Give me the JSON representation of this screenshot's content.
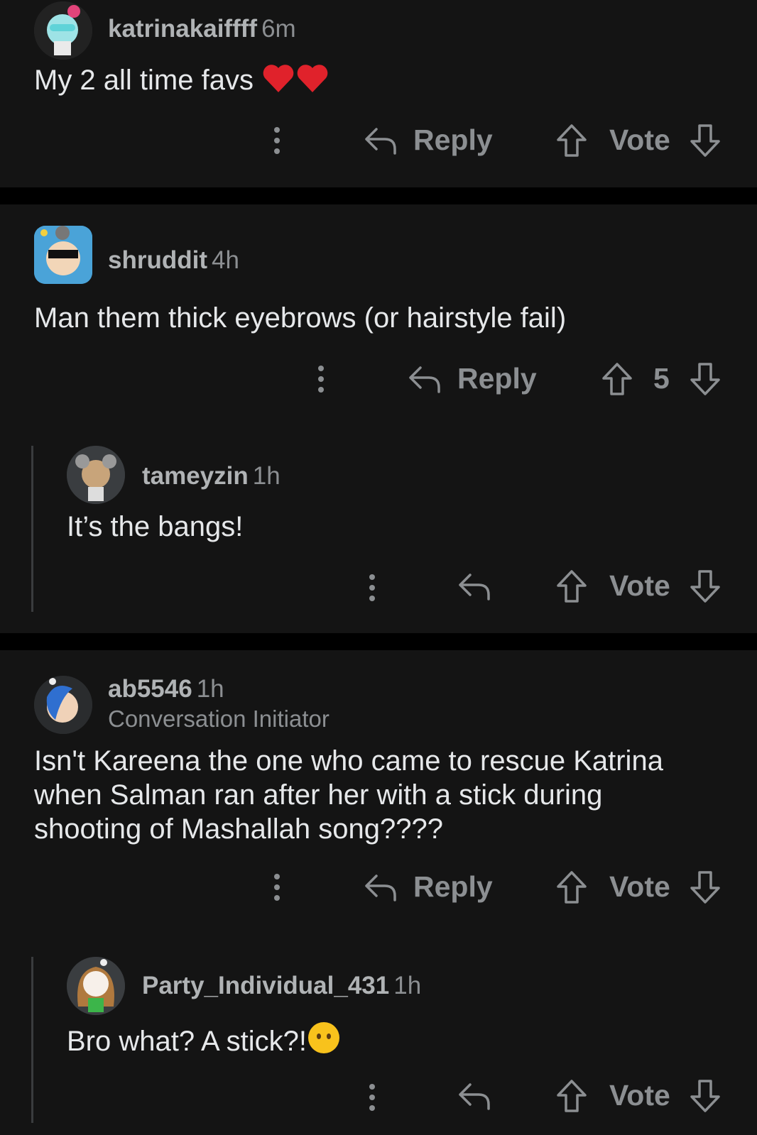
{
  "comments": [
    {
      "username": "katrinakaiffff",
      "time": "6m",
      "text": "My 2 all time favs",
      "reply_label": "Reply",
      "vote_label": "Vote"
    },
    {
      "username": "shruddit",
      "time": "4h",
      "text": "Man them thick eyebrows (or hairstyle fail)",
      "reply_label": "Reply",
      "vote_count": "5"
    },
    {
      "username": "tameyzin",
      "time": "1h",
      "text": "It’s the bangs!",
      "vote_label": "Vote"
    },
    {
      "username": "ab5546",
      "time": "1h",
      "flair": "Conversation Initiator",
      "text": "Isn't Kareena the one who came to rescue Katrina when Salman ran after her with a stick during shooting of Mashallah song????",
      "reply_label": "Reply",
      "vote_label": "Vote"
    },
    {
      "username": "Party_Individual_431",
      "time": "1h",
      "text": "Bro what? A stick?!",
      "vote_label": "Vote"
    }
  ],
  "icons": {
    "more": "more-vertical-icon",
    "reply": "reply-arrow-icon",
    "upvote": "upvote-arrow-icon",
    "downvote": "downvote-arrow-icon"
  },
  "colors": {
    "background": "#141414",
    "separator": "#000000",
    "muted": "#8c8f92",
    "text": "#e6e8ea"
  }
}
